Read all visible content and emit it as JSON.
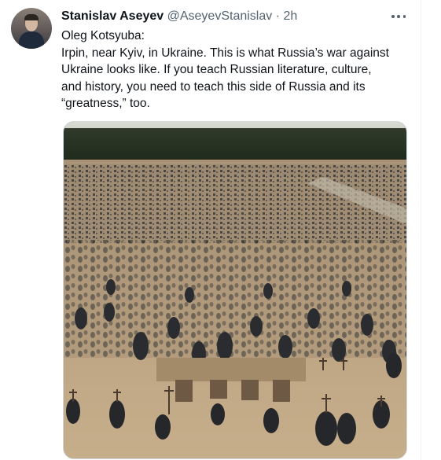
{
  "tweet": {
    "author_name": "Stanislav Aseyev",
    "author_handle": "@AseyevStanislav",
    "separator": "·",
    "time": "2h",
    "text_lines": [
      "Oleg Kotsyuba:",
      "Irpin, near Kyiv, in Ukraine. This is what Russia’s war against",
      "Ukraine looks like. If you teach Russian literature, culture,",
      "and history, you need to teach this side of Russia and its",
      "“greatness,” too."
    ],
    "more_icon": "more-horizontal-icon"
  }
}
